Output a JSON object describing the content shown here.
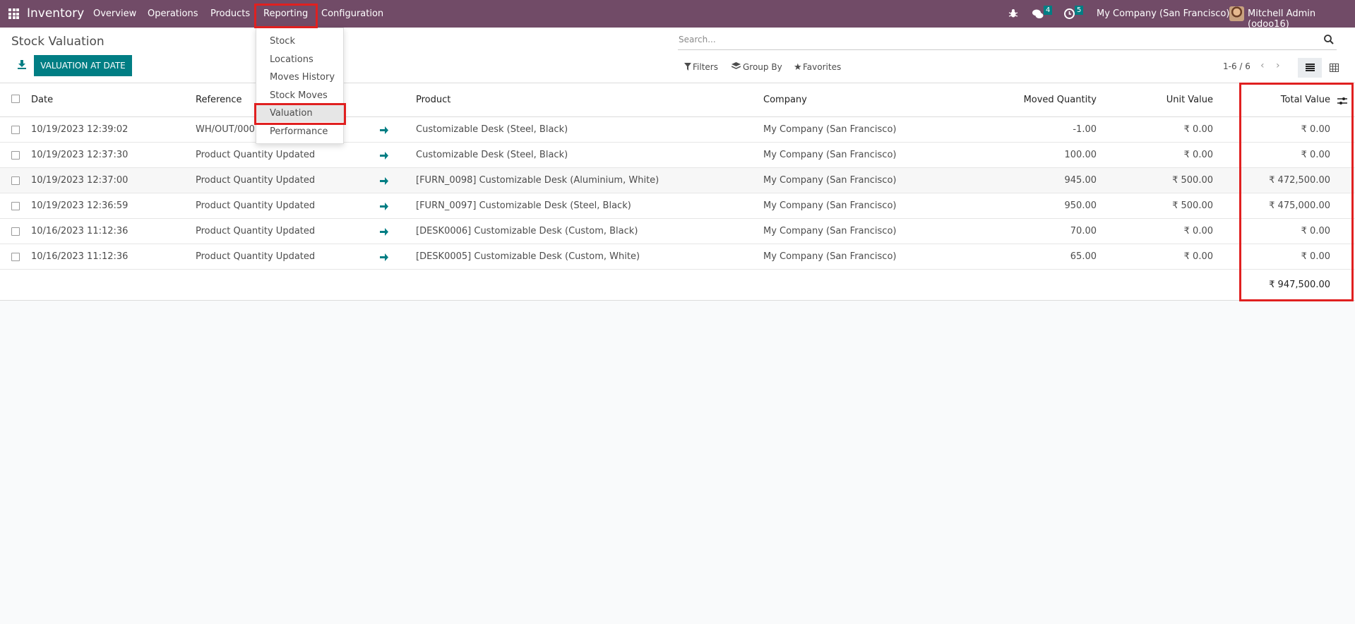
{
  "navbar": {
    "app_name": "Inventory",
    "menus": [
      "Overview",
      "Operations",
      "Products",
      "Reporting",
      "Configuration"
    ],
    "messages_count": "4",
    "activities_count": "5",
    "company": "My Company (San Francisco)",
    "user": "Mitchell Admin (odoo16)"
  },
  "dropdown": {
    "items": [
      "Stock",
      "Locations",
      "Moves History",
      "Stock Moves",
      "Valuation",
      "Performance"
    ],
    "active": "Valuation"
  },
  "panel": {
    "title": "Stock Valuation",
    "valuation_button": "VALUATION AT DATE",
    "search_placeholder": "Search...",
    "filters": "Filters",
    "group_by": "Group By",
    "favorites": "Favorites",
    "pager": "1-6 / 6"
  },
  "table": {
    "headers": {
      "date": "Date",
      "reference": "Reference",
      "product": "Product",
      "company": "Company",
      "moved_quantity": "Moved Quantity",
      "unit_value": "Unit Value",
      "total_value": "Total Value"
    },
    "rows": [
      {
        "date": "10/19/2023 12:39:02",
        "reference": "WH/OUT/0001",
        "product": "Customizable Desk (Steel, Black)",
        "company": "My Company (San Francisco)",
        "qty": "-1.00",
        "unit": "₹ 0.00",
        "total": "₹ 0.00"
      },
      {
        "date": "10/19/2023 12:37:30",
        "reference": "Product Quantity Updated",
        "product": "Customizable Desk (Steel, Black)",
        "company": "My Company (San Francisco)",
        "qty": "100.00",
        "unit": "₹ 0.00",
        "total": "₹ 0.00"
      },
      {
        "date": "10/19/2023 12:37:00",
        "reference": "Product Quantity Updated",
        "product": "[FURN_0098] Customizable Desk (Aluminium, White)",
        "company": "My Company (San Francisco)",
        "qty": "945.00",
        "unit": "₹ 500.00",
        "total": "₹ 472,500.00"
      },
      {
        "date": "10/19/2023 12:36:59",
        "reference": "Product Quantity Updated",
        "product": "[FURN_0097] Customizable Desk (Steel, Black)",
        "company": "My Company (San Francisco)",
        "qty": "950.00",
        "unit": "₹ 500.00",
        "total": "₹ 475,000.00"
      },
      {
        "date": "10/16/2023 11:12:36",
        "reference": "Product Quantity Updated",
        "product": "[DESK0006] Customizable Desk (Custom, Black)",
        "company": "My Company (San Francisco)",
        "qty": "70.00",
        "unit": "₹ 0.00",
        "total": "₹ 0.00"
      },
      {
        "date": "10/16/2023 11:12:36",
        "reference": "Product Quantity Updated",
        "product": "[DESK0005] Customizable Desk (Custom, White)",
        "company": "My Company (San Francisco)",
        "qty": "65.00",
        "unit": "₹ 0.00",
        "total": "₹ 0.00"
      }
    ],
    "footer_total": "₹ 947,500.00"
  },
  "colors": {
    "brand": "#714b67",
    "primary": "#017e84",
    "highlight": "#e02020"
  },
  "icons": [
    "apps-grid-icon",
    "bug-icon",
    "chat-icon",
    "clock-icon",
    "avatar",
    "download-icon",
    "search-icon",
    "filter-icon",
    "layers-icon",
    "star-icon",
    "list-view-icon",
    "pivot-view-icon",
    "arrow-right-icon",
    "optional-columns-icon"
  ]
}
